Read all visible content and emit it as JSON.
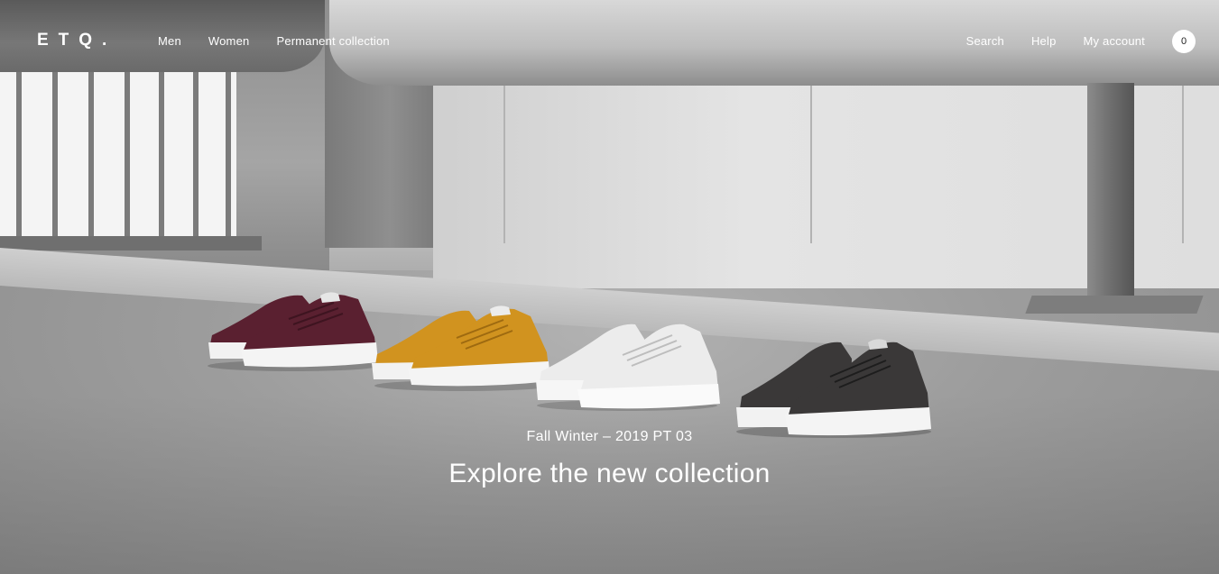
{
  "brand": {
    "logo_text": "ETQ."
  },
  "nav": {
    "primary": [
      {
        "label": "Men"
      },
      {
        "label": "Women"
      },
      {
        "label": "Permanent collection"
      }
    ],
    "utility": [
      {
        "label": "Search"
      },
      {
        "label": "Help"
      },
      {
        "label": "My account"
      }
    ],
    "cart_count": "0"
  },
  "hero": {
    "subtitle": "Fall Winter – 2019 PT 03",
    "title": "Explore the new collection",
    "sneaker_colors": [
      "#5a2030",
      "#d1931f",
      "#ececec",
      "#3a3838"
    ]
  }
}
